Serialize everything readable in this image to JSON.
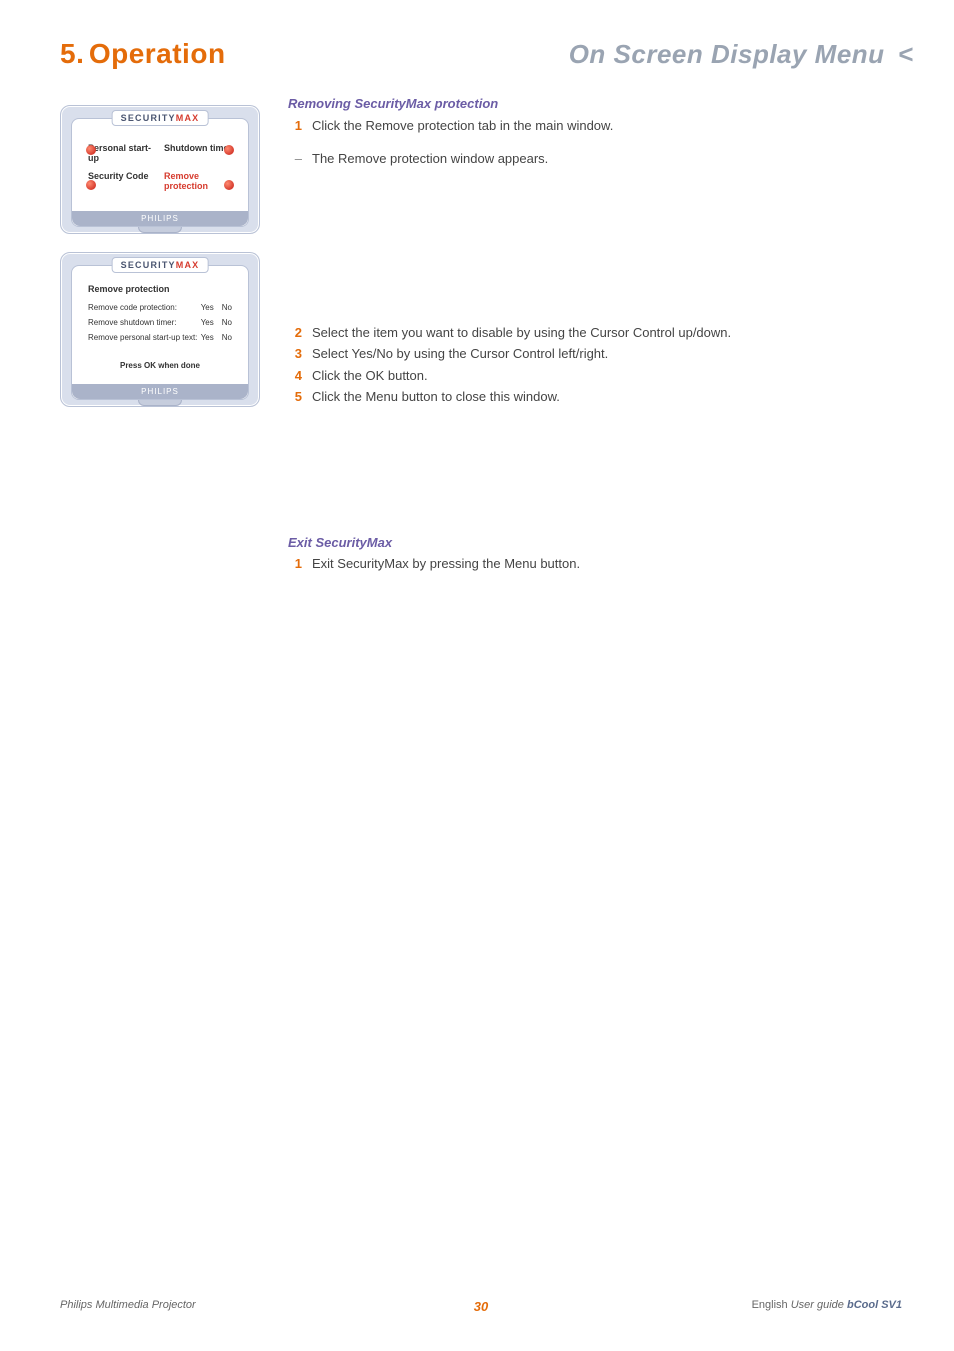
{
  "header": {
    "section_no": "5.",
    "section_title": "Operation",
    "breadcrumb": "On Screen Display Menu",
    "chevron": "<"
  },
  "illus1": {
    "logo_prefix": "SECURITY",
    "logo_suffix": "MAX",
    "menu": [
      "Personal start-up",
      "Shutdown timer",
      "Security Code",
      "Remove protection"
    ],
    "brand": "PHILIPS"
  },
  "illus2": {
    "logo_prefix": "SECURITY",
    "logo_suffix": "MAX",
    "title": "Remove protection",
    "rows": [
      {
        "label": "Remove code protection:",
        "yes": "Yes",
        "no": "No"
      },
      {
        "label": "Remove shutdown timer:",
        "yes": "Yes",
        "no": "No"
      },
      {
        "label": "Remove personal start-up text:",
        "yes": "Yes",
        "no": "No"
      }
    ],
    "ok_hint": "Press OK when done",
    "brand": "PHILIPS"
  },
  "section1": {
    "title": "Removing SecurityMax protection",
    "steps": [
      {
        "n": "1",
        "t": "Click the Remove protection tab in the main window."
      }
    ],
    "sub": {
      "dash": "–",
      "t": "The Remove protection window appears."
    }
  },
  "section2": {
    "steps": [
      {
        "n": "2",
        "t": "Select the item you want to disable by using the Cursor Control up/down."
      },
      {
        "n": "3",
        "t": "Select Yes/No by using the Cursor Control left/right."
      },
      {
        "n": "4",
        "t": "Click the OK button."
      },
      {
        "n": "5",
        "t": "Click the Menu button to close this window."
      }
    ]
  },
  "section3": {
    "title": "Exit SecurityMax",
    "steps": [
      {
        "n": "1",
        "t": "Exit SecurityMax by pressing the Menu button."
      }
    ]
  },
  "footer": {
    "left": "Philips Multimedia Projector",
    "page": "30",
    "right_lang": "English",
    "right_guide": "User guide",
    "right_model": "bCool SV1"
  }
}
